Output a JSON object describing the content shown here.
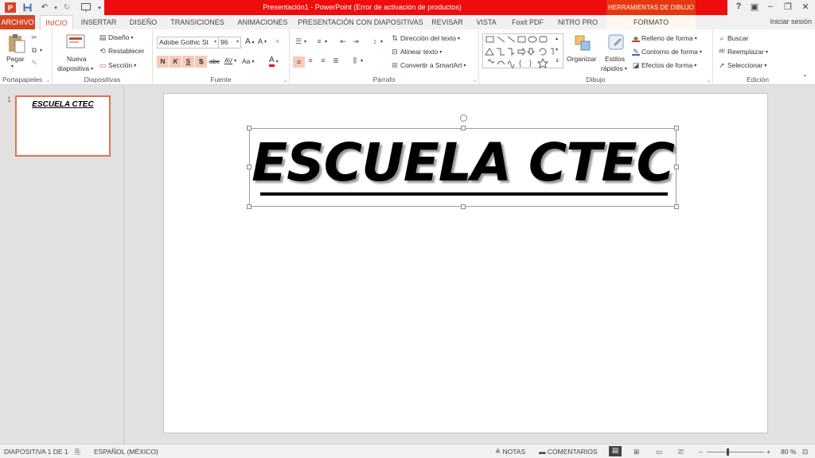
{
  "titlebar": {
    "title": "Presentación1 -  PowerPoint (Error de activación de productos)",
    "context_group": "HERRAMIENTAS DE DIBUJO",
    "icons": [
      "powerpoint-icon",
      "save-icon",
      "undo-icon",
      "redo-icon",
      "start-from-beginning-icon",
      "customize-qat-icon"
    ],
    "controls": {
      "help": "?",
      "ribbon_options": "▣",
      "minimize": "–",
      "restore": "❐",
      "close": "✕"
    }
  },
  "tabs": {
    "file": "ARCHIVO",
    "home": "INICIO",
    "insert": "INSERTAR",
    "design": "DISEÑO",
    "transitions": "TRANSICIONES",
    "animations": "ANIMACIONES",
    "slideshow": "PRESENTACIÓN CON DIAPOSITIVAS",
    "review": "REVISAR",
    "view": "VISTA",
    "foxit": "Foxit PDF",
    "nitro": "NITRO PRO",
    "format": "FORMATO",
    "signin": "Iniciar sesión"
  },
  "ribbon": {
    "clipboard": {
      "paste": "Pegar",
      "label": "Portapapeles"
    },
    "slides": {
      "new_slide_1": "Nueva",
      "new_slide_2": "diapositiva",
      "layout": "Diseño",
      "reset": "Restablecer",
      "section": "Sección",
      "label": "Diapositivas"
    },
    "font": {
      "font_name": "Adobe Gothic St",
      "font_size": "96",
      "bold": "N",
      "italic": "K",
      "underline": "S",
      "shadow": "S",
      "strike": "abc",
      "spacing": "AV",
      "case": "Aa",
      "color": "A",
      "label": "Fuente"
    },
    "paragraph": {
      "text_direction": "Dirección del texto",
      "align_text": "Alinear texto",
      "smartart": "Convertir a SmartArt",
      "label": "Párrafo"
    },
    "drawing": {
      "arrange": "Organizar",
      "styles_1": "Estilos",
      "styles_2": "rápidos",
      "fill": "Relleno de forma",
      "outline": "Contorno de forma",
      "effects": "Efectos de forma",
      "label": "Dibujo"
    },
    "editing": {
      "find": "Buscar",
      "replace": "Reemplazar",
      "select": "Seleccionar",
      "label": "Edición"
    }
  },
  "thumbnails": [
    {
      "number": "1",
      "text": "ESCUELA   CTEC"
    }
  ],
  "slide": {
    "title": "ESCUELA  CTEC"
  },
  "status": {
    "slide_info": "DIAPOSITIVA 1 DE 1",
    "language": "ESPAÑOL (MÉXICO)",
    "notes": "NOTAS",
    "comments": "COMENTARIOS",
    "zoom": "80 %"
  },
  "colors": {
    "accent": "#d24726",
    "title_red": "#ef0c0c",
    "context_tab": "#e5380f"
  }
}
